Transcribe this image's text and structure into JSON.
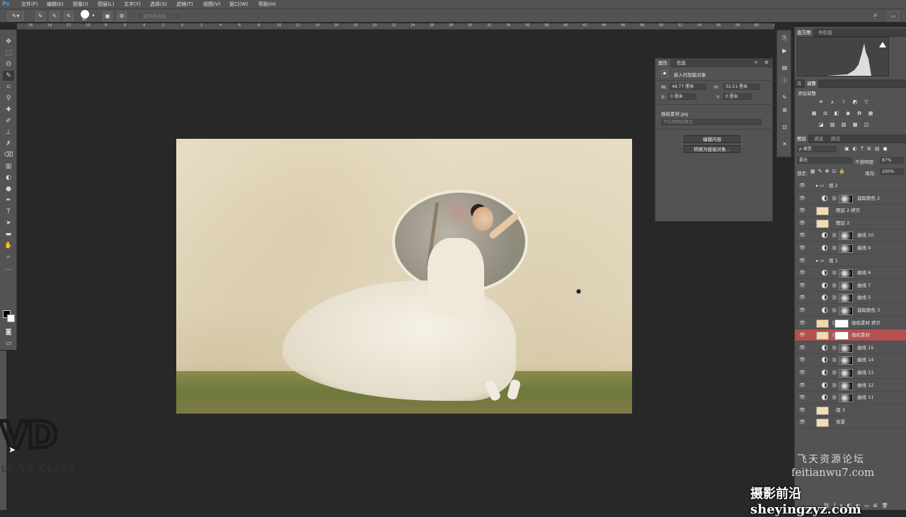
{
  "app": {
    "logo": "Ps"
  },
  "menu": [
    "文件(F)",
    "编辑(E)",
    "图像(I)",
    "图层(L)",
    "文字(Y)",
    "选择(S)",
    "滤镜(T)",
    "视图(V)",
    "窗口(W)",
    "帮助(H)"
  ],
  "options_bar": {
    "brush_size": "90",
    "subject_label": "选择并遮住..."
  },
  "ruler_ticks": [
    "16",
    "14",
    "12",
    "10",
    "8",
    "6",
    "4",
    "2",
    "0",
    "2",
    "4",
    "6",
    "8",
    "10",
    "12",
    "14",
    "16",
    "18",
    "20",
    "22",
    "24",
    "26",
    "28",
    "30",
    "32",
    "34",
    "36",
    "38",
    "40",
    "42",
    "44",
    "46",
    "48",
    "50",
    "52",
    "54",
    "56",
    "58",
    "60",
    "62"
  ],
  "properties": {
    "tabs": [
      "属性",
      "信息"
    ],
    "type_label": "嵌入的智能对象",
    "w_label": "W:",
    "w_value": "48.77 厘米",
    "h_label": "H:",
    "h_value": "32.51 厘米",
    "x_label": "X:",
    "x_value": "0 厘米",
    "y_label": "Y:",
    "y_value": "0 厘米",
    "filename": "画纸素材.jpg",
    "comp_placeholder": "不应用图层复合",
    "edit_button": "编辑内容",
    "convert_button": "转换为链接对象..."
  },
  "right_panel": {
    "histo_tabs": [
      "直方图",
      "导航器"
    ],
    "adj_tabs": [
      "库",
      "调整"
    ],
    "adj_title": "添加调整",
    "layer_tabs": [
      "图层",
      "通道",
      "路径"
    ],
    "kind_label": "ρ 类型",
    "blend_mode": "柔光",
    "opacity_label": "不透明度:",
    "opacity_value": "87%",
    "lock_label": "锁定:",
    "fill_label": "填充:",
    "fill_value": "100%",
    "layers": [
      {
        "name": "组 2",
        "type": "group"
      },
      {
        "name": "选取颜色 2",
        "type": "adj"
      },
      {
        "name": "图层 2 拷贝",
        "type": "pixel"
      },
      {
        "name": "图层 2",
        "type": "pixel"
      },
      {
        "name": "曲线 10",
        "type": "adj"
      },
      {
        "name": "曲线 9",
        "type": "adj"
      },
      {
        "name": "组 1",
        "type": "group"
      },
      {
        "name": "曲线 6",
        "type": "adj"
      },
      {
        "name": "曲线 7",
        "type": "adj"
      },
      {
        "name": "曲线 5",
        "type": "adj"
      },
      {
        "name": "选取颜色 3",
        "type": "adj"
      },
      {
        "name": "画纸素材 拷贝",
        "type": "smart"
      },
      {
        "name": "画纸素材",
        "type": "smart",
        "selected": true
      },
      {
        "name": "曲线 15",
        "type": "adj"
      },
      {
        "name": "曲线 14",
        "type": "adj"
      },
      {
        "name": "曲线 13",
        "type": "adj"
      },
      {
        "name": "曲线 12",
        "type": "adj"
      },
      {
        "name": "曲线 11",
        "type": "adj"
      },
      {
        "name": "组 3",
        "type": "pixel"
      },
      {
        "name": "背景",
        "type": "pixel"
      }
    ]
  },
  "watermarks": {
    "logo_text": "VD",
    "logo_sub": "LE VR CLASS",
    "site_cn": "飞天资源论坛",
    "site_url": "feitianwu7.com",
    "bottom": "摄影前沿 sheyingzyz.com"
  },
  "colors": {
    "selected_layer": "#b45050",
    "accent": "#31a8ff"
  }
}
